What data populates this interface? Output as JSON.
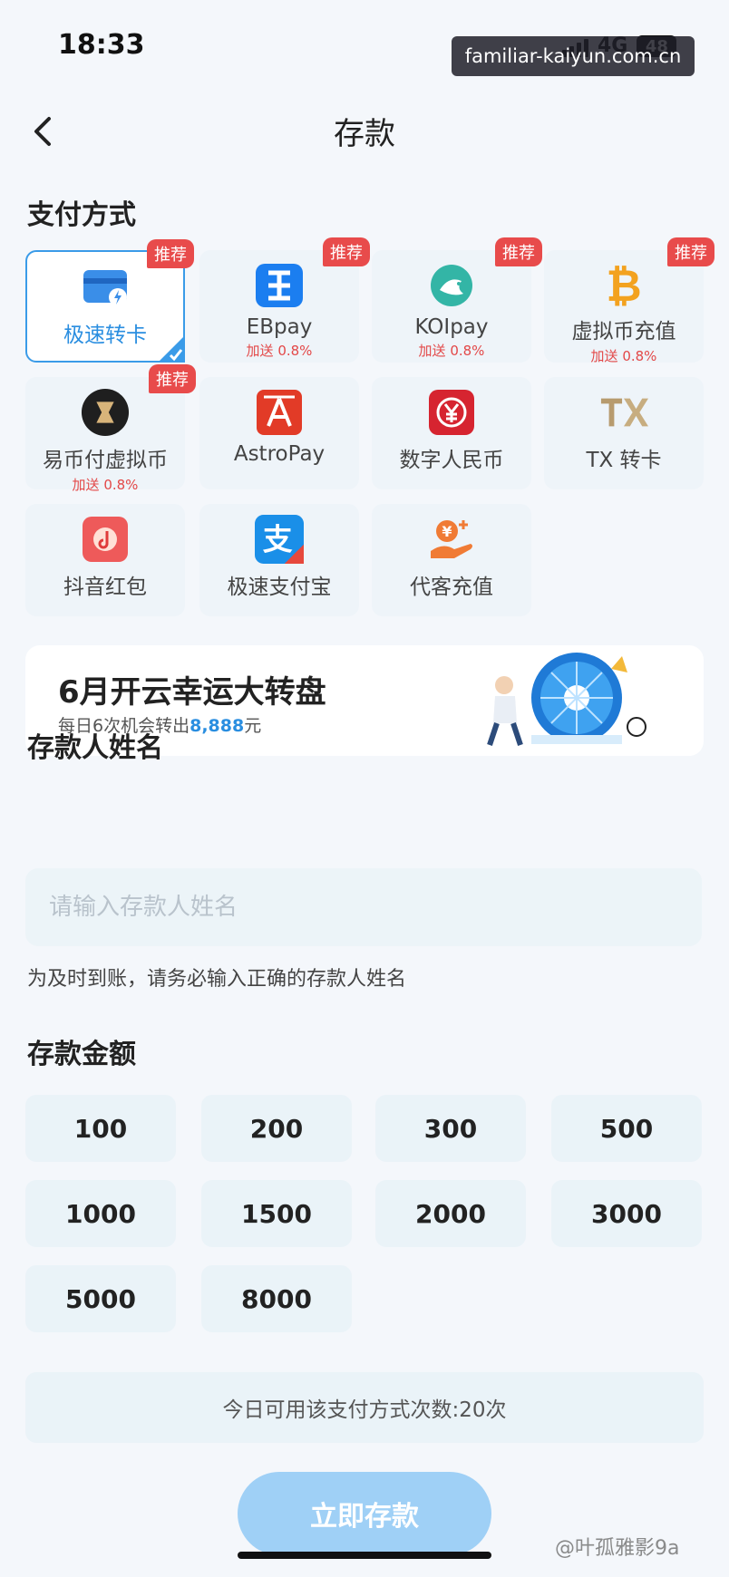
{
  "status_bar": {
    "time": "18:33",
    "network": "4G",
    "battery": "48",
    "overlay_url": "familiar-kaiyun.com.cn"
  },
  "header": {
    "title": "存款"
  },
  "payment": {
    "section_title": "支付方式",
    "methods": [
      {
        "name": "极速转卡",
        "bonus": "",
        "tag": "推荐",
        "selected": true,
        "icon": "card-lightning-icon"
      },
      {
        "name": "EBpay",
        "bonus": "加送 0.8%",
        "tag": "推荐",
        "selected": false,
        "icon": "ebpay-icon"
      },
      {
        "name": "KOIpay",
        "bonus": "加送 0.8%",
        "tag": "推荐",
        "selected": false,
        "icon": "koi-icon"
      },
      {
        "name": "虚拟币充值",
        "bonus": "加送 0.8%",
        "tag": "推荐",
        "selected": false,
        "icon": "bitcoin-icon"
      },
      {
        "name": "易币付虚拟币",
        "bonus": "加送 0.8%",
        "tag": "推荐",
        "selected": false,
        "icon": "yibifu-icon"
      },
      {
        "name": "AstroPay",
        "bonus": "",
        "tag": "",
        "selected": false,
        "icon": "astropay-icon"
      },
      {
        "name": "数字人民币",
        "bonus": "",
        "tag": "",
        "selected": false,
        "icon": "digital-rmb-icon"
      },
      {
        "name": "TX 转卡",
        "bonus": "",
        "tag": "",
        "selected": false,
        "icon": "tx-icon"
      },
      {
        "name": "抖音红包",
        "bonus": "",
        "tag": "",
        "selected": false,
        "icon": "douyin-redpacket-icon"
      },
      {
        "name": "极速支付宝",
        "bonus": "",
        "tag": "",
        "selected": false,
        "icon": "alipay-icon"
      },
      {
        "name": "代客充值",
        "bonus": "",
        "tag": "",
        "selected": false,
        "icon": "agent-recharge-icon"
      }
    ]
  },
  "banner": {
    "title": "6月开云幸运大转盘",
    "sub_prefix": "每日6次机会转出",
    "sub_amount": "8,888",
    "sub_suffix": "元"
  },
  "depositor": {
    "section_title": "存款人姓名",
    "placeholder": "请输入存款人姓名",
    "value": "",
    "hint": "为及时到账，请务必输入正确的存款人姓名"
  },
  "amount": {
    "section_title": "存款金额",
    "options": [
      "100",
      "200",
      "300",
      "500",
      "1000",
      "1500",
      "2000",
      "3000",
      "5000",
      "8000"
    ]
  },
  "limit_text": "今日可用该支付方式次数:20次",
  "submit_label": "立即存款",
  "corner_watermark": "@叶孤雅影9a",
  "colors": {
    "accent": "#3a9be8",
    "tag_red": "#e84b4b",
    "button_light": "#9fd0f6"
  }
}
